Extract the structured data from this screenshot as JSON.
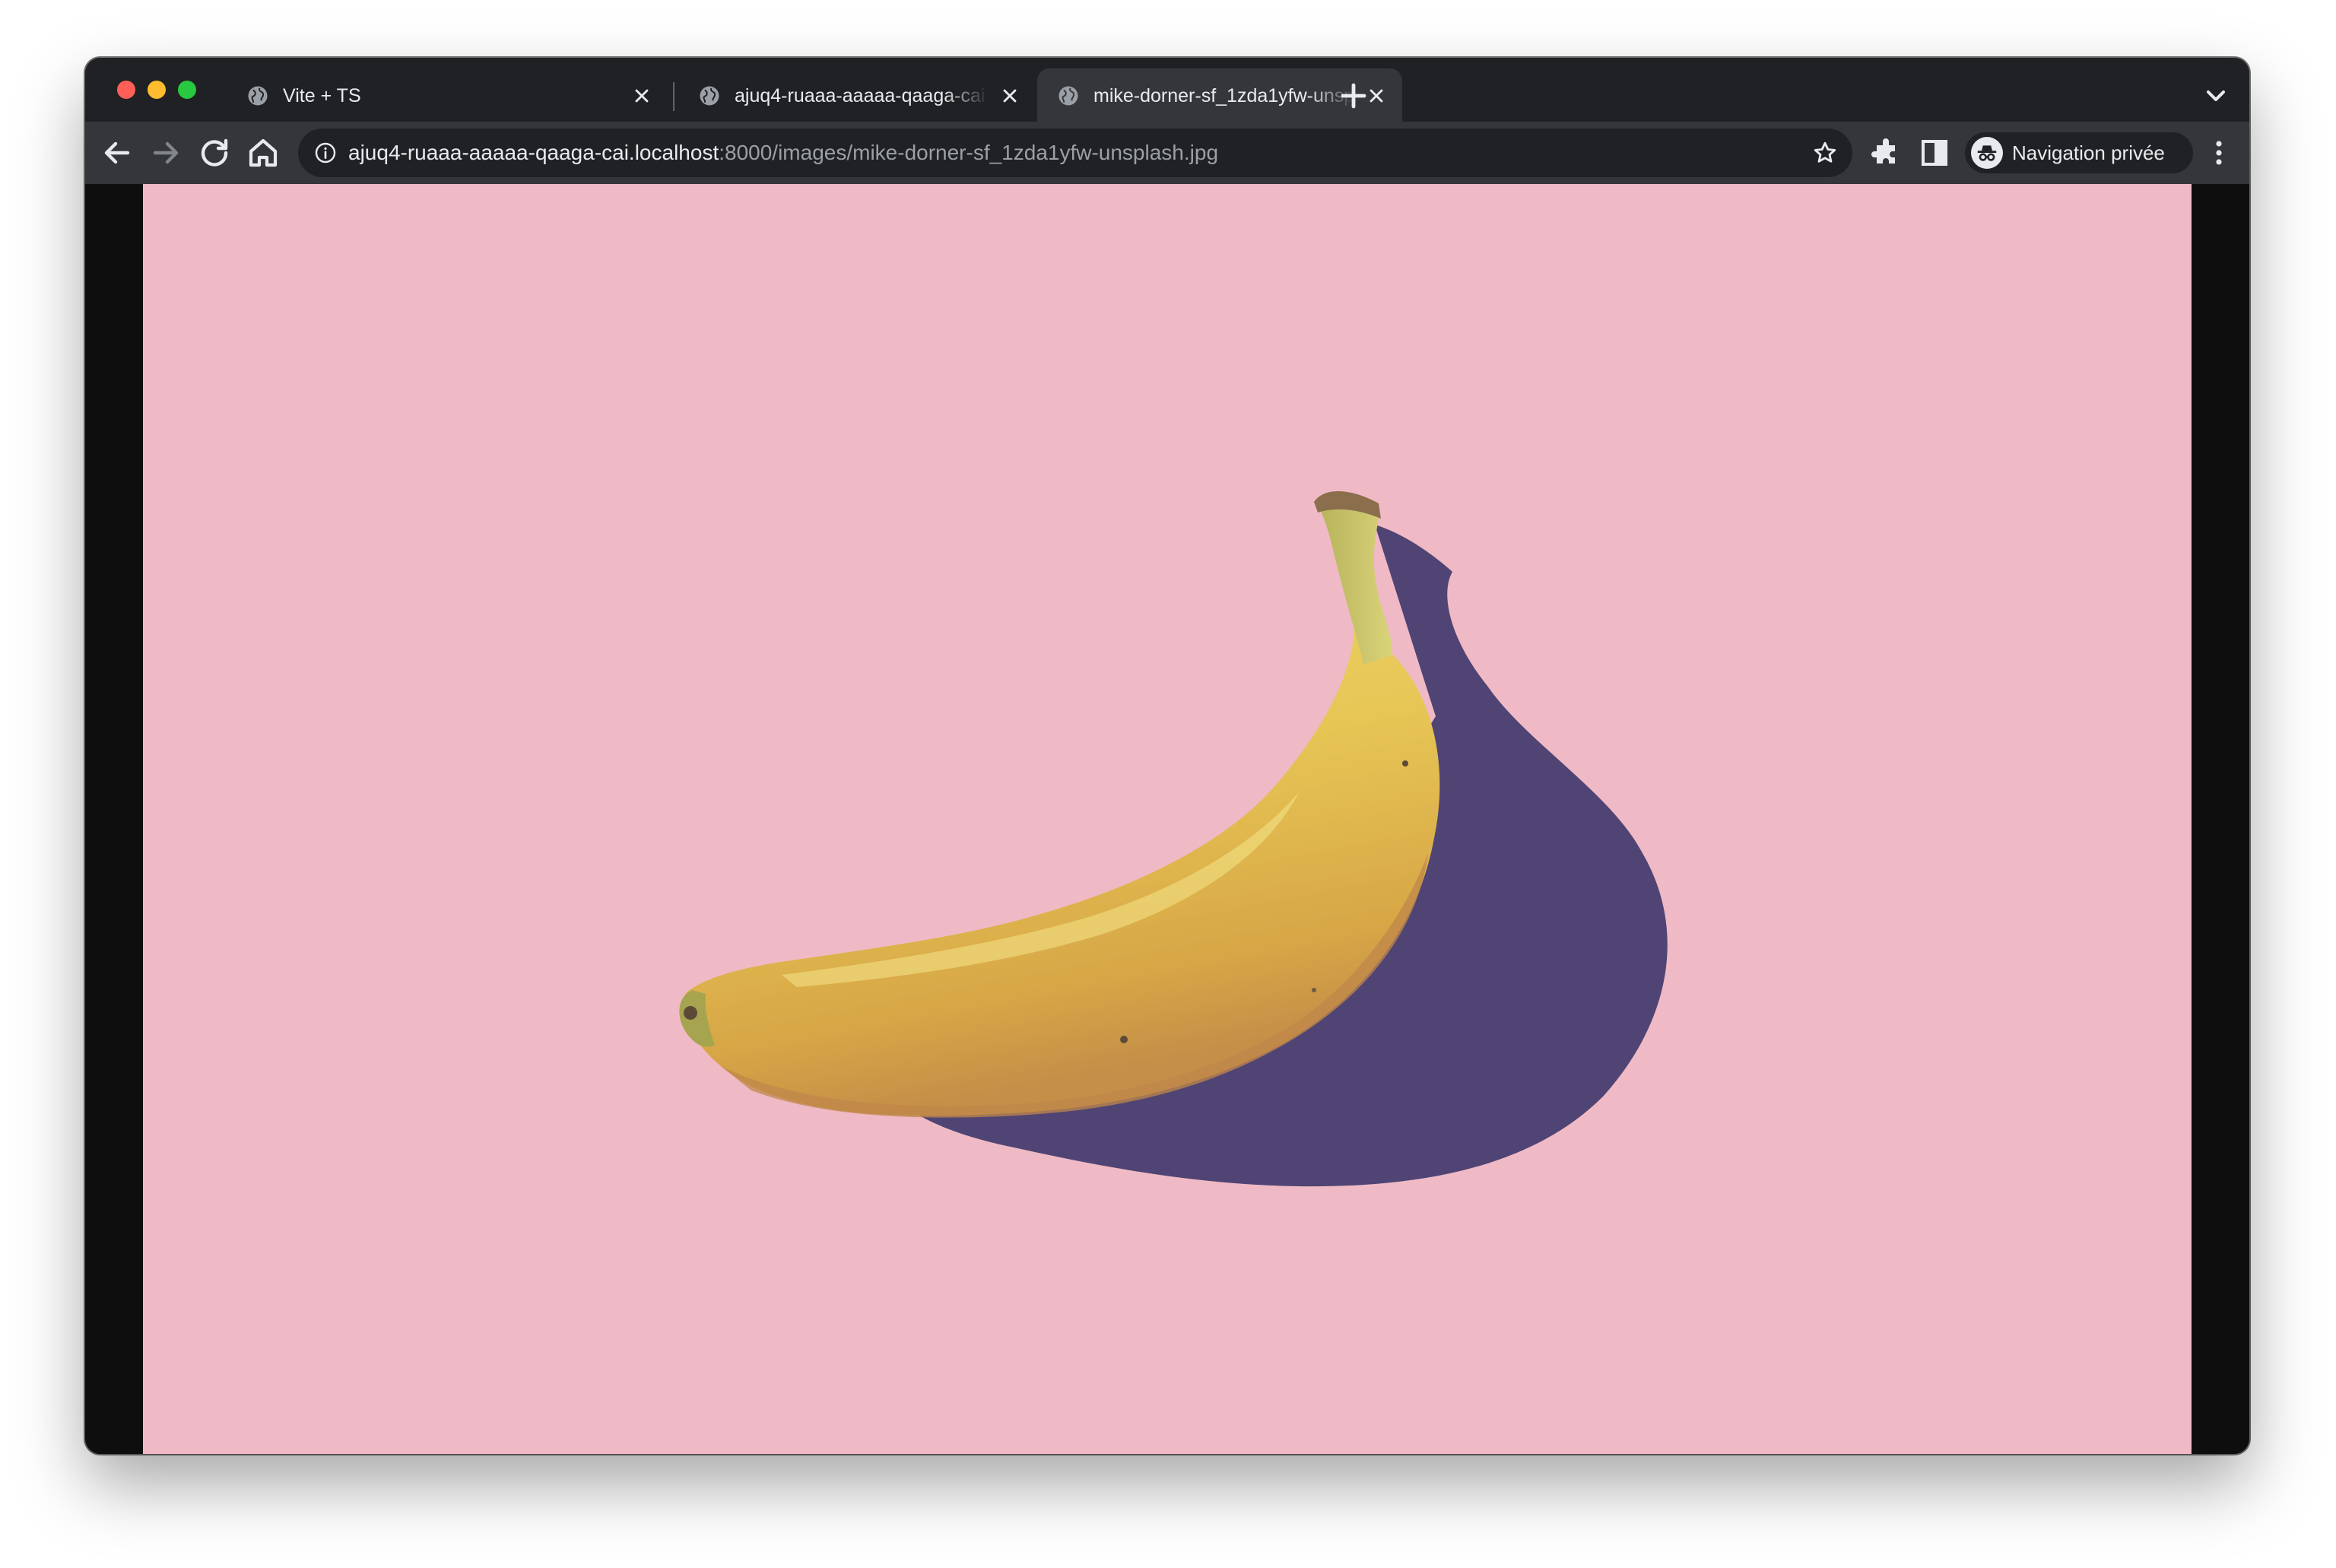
{
  "window": {
    "traffic_lights": {
      "close_color": "#ff5f57",
      "minimize_color": "#febc2e",
      "zoom_color": "#28c840"
    }
  },
  "tabs": [
    {
      "title": "Vite + TS",
      "favicon": "globe-icon",
      "active": false
    },
    {
      "title": "ajuq4-ruaaa-aaaaa-qaaga-cai",
      "favicon": "globe-icon",
      "active": false
    },
    {
      "title": "mike-dorner-sf_1zda1yfw-unsplash.jpg",
      "favicon": "globe-icon",
      "active": true
    }
  ],
  "toolbar": {
    "back_icon": "arrow-left-icon",
    "forward_icon": "arrow-right-icon",
    "reload_icon": "reload-icon",
    "home_icon": "home-icon",
    "address": {
      "host": "ajuq4-ruaaa-aaaaa-qaaga-cai.localhost",
      "path": ":8000/images/mike-dorner-sf_1zda1yfw-unsplash.jpg"
    },
    "bookmark_icon": "star-icon",
    "extensions_icon": "puzzle-icon",
    "side_panel_icon": "side-panel-icon",
    "profile_label": "Navigation privée",
    "profile_icon": "incognito-icon",
    "menu_icon": "kebab-menu-icon"
  },
  "content": {
    "image_subject": "banana",
    "background_color": "#efbac5",
    "letterbox_color": "#0e0e0e"
  }
}
